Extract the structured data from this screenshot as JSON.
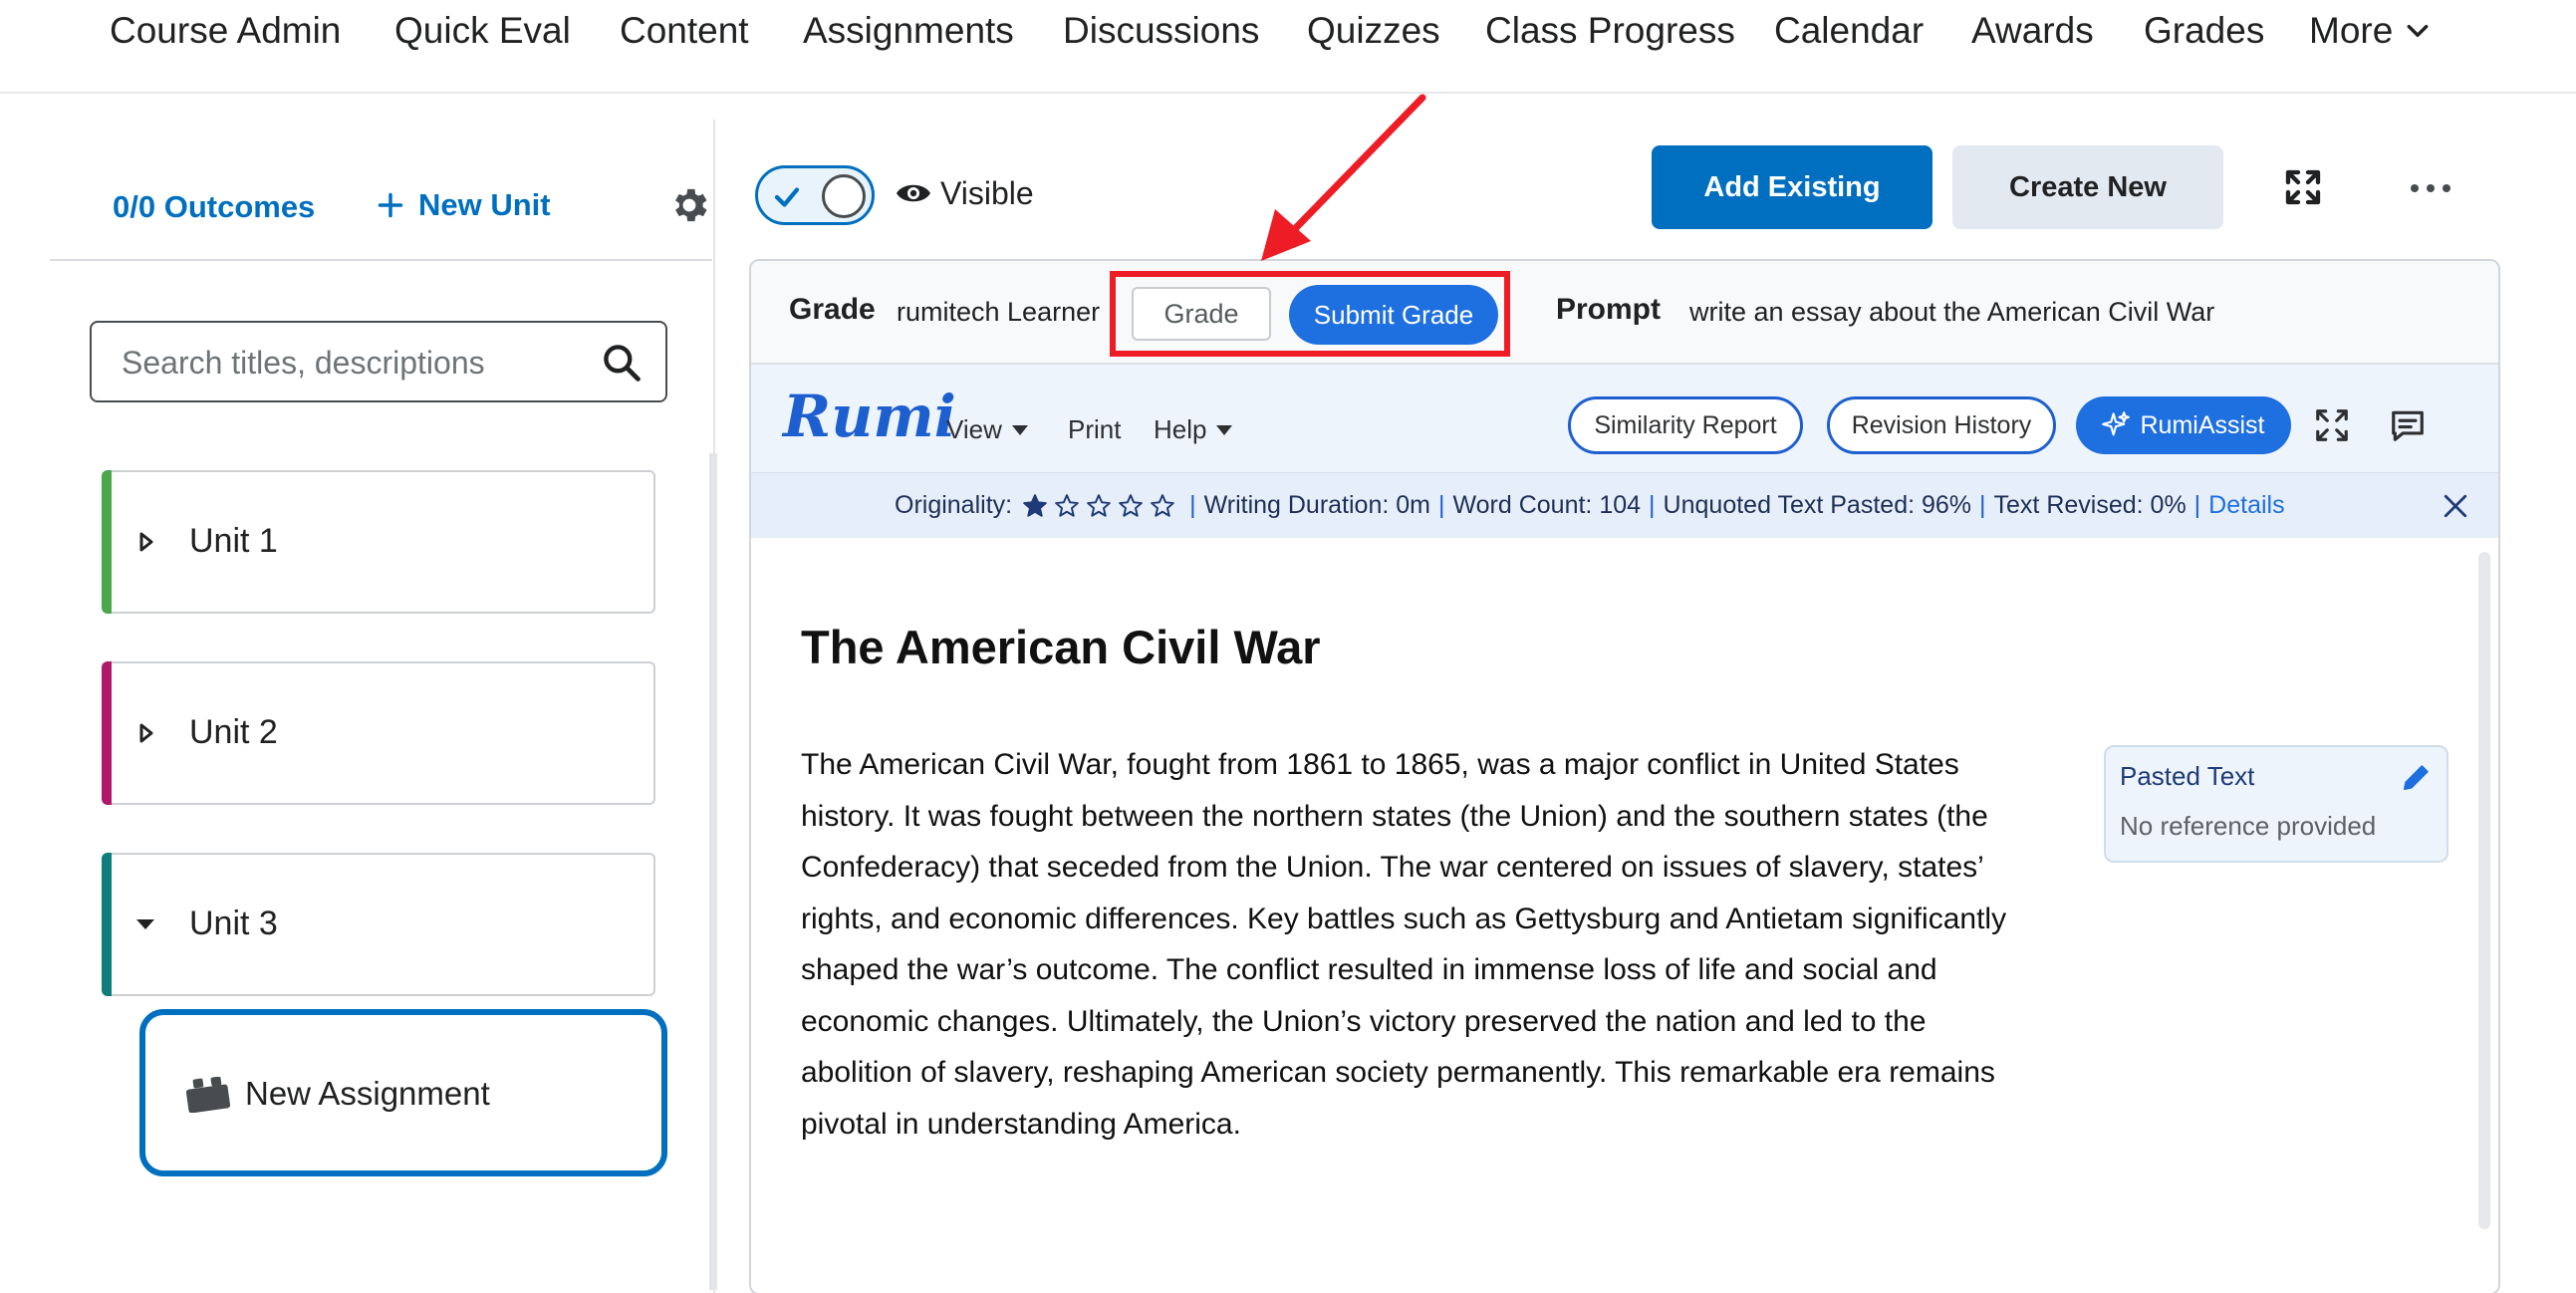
{
  "nav": {
    "items": [
      "Course Admin",
      "Quick Eval",
      "Content",
      "Assignments",
      "Discussions",
      "Quizzes",
      "Class Progress",
      "Calendar",
      "Awards",
      "Grades"
    ],
    "more_label": "More"
  },
  "sidebar": {
    "outcomes_label": "0/0 Outcomes",
    "new_unit_label": "New Unit",
    "search_placeholder": "Search titles, descriptions",
    "units": [
      {
        "label": "Unit 1",
        "color": "#4aa74a",
        "expanded": false
      },
      {
        "label": "Unit 2",
        "color": "#b0196b",
        "expanded": false
      },
      {
        "label": "Unit 3",
        "color": "#0f7d7d",
        "expanded": true
      }
    ],
    "assignment_label": "New Assignment"
  },
  "header": {
    "visible_label": "Visible",
    "add_existing_label": "Add Existing",
    "create_new_label": "Create New"
  },
  "grade_bar": {
    "grade_label": "Grade",
    "learner": "rumitech Learner",
    "grade_placeholder": "Grade",
    "submit_label": "Submit Grade",
    "prompt_label": "Prompt",
    "prompt_text": "write an essay about the American Civil War"
  },
  "rumi": {
    "logo": "Rumi",
    "menu": {
      "view": "View",
      "print": "Print",
      "help": "Help"
    },
    "similarity_label": "Similarity Report",
    "revision_label": "Revision History",
    "assist_label": "RumiAssist",
    "stats": {
      "originality_label": "Originality:",
      "originality_stars": 1,
      "writing_duration": "Writing Duration: 0m",
      "word_count": "Word Count: 104",
      "unquoted": "Unquoted Text Pasted: 96%",
      "revised": "Text Revised: 0%",
      "details_label": "Details"
    }
  },
  "document": {
    "title": "The American Civil War",
    "body": "The American Civil War, fought from 1861 to 1865, was a major conflict in United States history. It was fought between the northern states (the Union) and the southern states (the Confederacy) that seceded from the Union. The war centered on issues of slavery, states’ rights, and economic differences. Key battles such as Gettysburg and Antietam significantly shaped the war’s outcome. The conflict resulted in immense loss of life and social and economic changes. Ultimately, the Union’s victory preserved the nation and led to the abolition of slavery, reshaping American society permanently. This remarkable era remains pivotal in understanding America."
  },
  "note": {
    "title": "Pasted Text",
    "text": "No reference provided"
  },
  "colors": {
    "accent": "#006fbf",
    "rumi_blue": "#1e6fe0",
    "highlight": "#ee1c24"
  }
}
